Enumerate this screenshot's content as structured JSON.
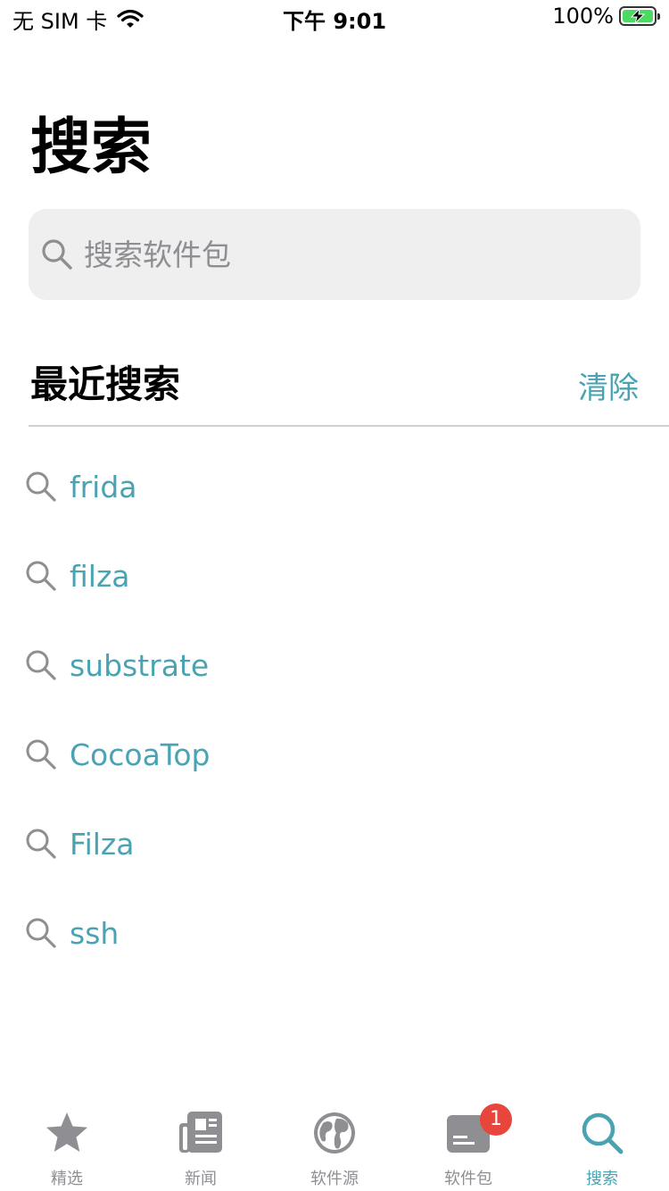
{
  "status_bar": {
    "carrier": "无 SIM 卡",
    "time": "下午 9:01",
    "battery_text": "100%",
    "battery_level": 1.0
  },
  "page": {
    "title": "搜索"
  },
  "search": {
    "placeholder": "搜索软件包",
    "value": ""
  },
  "recent": {
    "title": "最近搜索",
    "clear_label": "清除",
    "items": [
      {
        "label": "frida"
      },
      {
        "label": "filza"
      },
      {
        "label": "substrate"
      },
      {
        "label": "CocoaTop"
      },
      {
        "label": "Filza"
      },
      {
        "label": "ssh"
      }
    ]
  },
  "tabs": [
    {
      "label": "精选",
      "icon": "star-icon",
      "active": false
    },
    {
      "label": "新闻",
      "icon": "newspaper-icon",
      "active": false
    },
    {
      "label": "软件源",
      "icon": "globe-icon",
      "active": false
    },
    {
      "label": "软件包",
      "icon": "package-icon",
      "active": false,
      "badge": "1"
    },
    {
      "label": "搜索",
      "icon": "search-icon",
      "active": true
    }
  ],
  "colors": {
    "accent": "#4aa3b2",
    "inactive": "#8e8e93",
    "badge": "#e8453c",
    "search_bg": "#efefef"
  }
}
